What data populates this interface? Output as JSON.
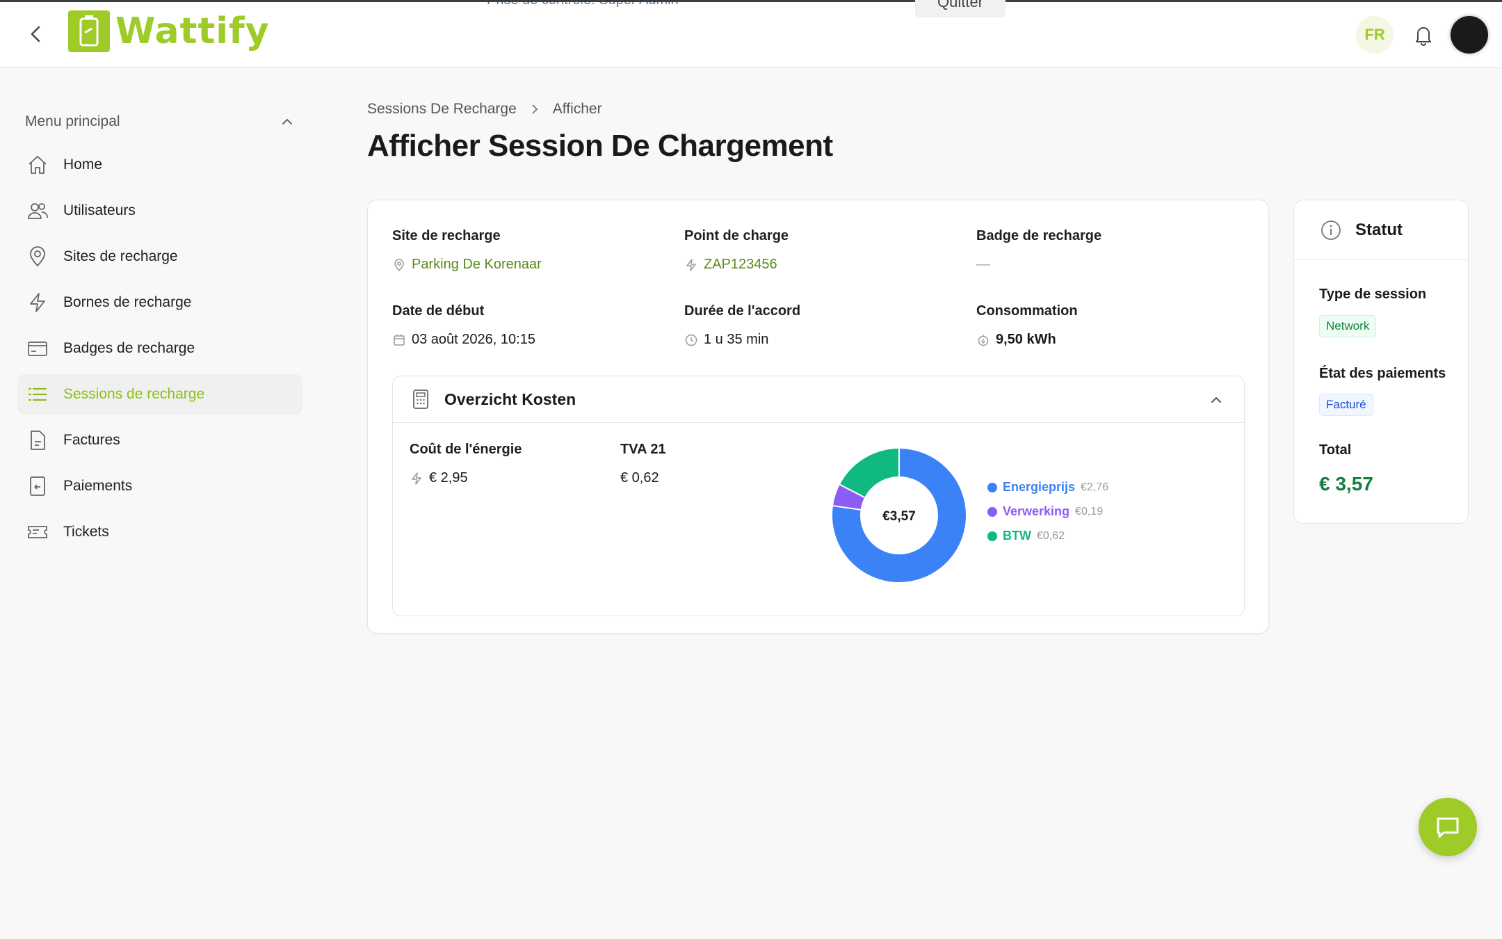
{
  "header": {
    "brand": "Wattify",
    "overlay_text": "Prise de contrôle: Super Admin",
    "overlay_button": "Quitter",
    "language": "FR"
  },
  "sidebar": {
    "title": "Menu principal",
    "items": [
      {
        "label": "Home",
        "icon": "home-icon"
      },
      {
        "label": "Utilisateurs",
        "icon": "users-icon"
      },
      {
        "label": "Sites de recharge",
        "icon": "location-pin-icon"
      },
      {
        "label": "Bornes de recharge",
        "icon": "lightning-icon"
      },
      {
        "label": "Badges de recharge",
        "icon": "card-icon"
      },
      {
        "label": "Sessions de recharge",
        "icon": "list-icon",
        "active": true
      },
      {
        "label": "Factures",
        "icon": "document-icon"
      },
      {
        "label": "Paiements",
        "icon": "receipt-icon"
      },
      {
        "label": "Tickets",
        "icon": "ticket-icon"
      }
    ]
  },
  "breadcrumb": {
    "parent": "Sessions De Recharge",
    "current": "Afficher"
  },
  "page_title": "Afficher Session De Chargement",
  "details": {
    "site_label": "Site de recharge",
    "site_value": "Parking De Korenaar",
    "point_label": "Point de charge",
    "point_value": "ZAP123456",
    "badge_label": "Badge de recharge",
    "badge_value": "—",
    "start_label": "Date de début",
    "start_value": "03 août 2026, 10:15",
    "duration_label": "Durée de l'accord",
    "duration_value": "1 u 35 min",
    "consumption_label": "Consommation",
    "consumption_value": "9,50 kWh"
  },
  "costs": {
    "title": "Overzicht Kosten",
    "energy_label": "Coût de l'énergie",
    "energy_value": "€ 2,95",
    "tva_label": "TVA 21",
    "tva_value": "€ 0,62",
    "donut_center": "€3,57",
    "legend": [
      {
        "name": "Energieprijs",
        "value_text": "€2,76",
        "value": 2.76,
        "color": "#3b82f6"
      },
      {
        "name": "Verwerking",
        "value_text": "€0,19",
        "value": 0.19,
        "color": "#8b5cf6"
      },
      {
        "name": "BTW",
        "value_text": "€0,62",
        "value": 0.62,
        "color": "#10b981"
      }
    ]
  },
  "status": {
    "title": "Statut",
    "type_label": "Type de session",
    "type_value": "Network",
    "payment_label": "État des paiements",
    "payment_value": "Facturé",
    "total_label": "Total",
    "total_value": "€ 3,57"
  },
  "colors": {
    "brand": "#9ecb28",
    "site_value": "#5a8a1a",
    "total": "#15803d"
  }
}
